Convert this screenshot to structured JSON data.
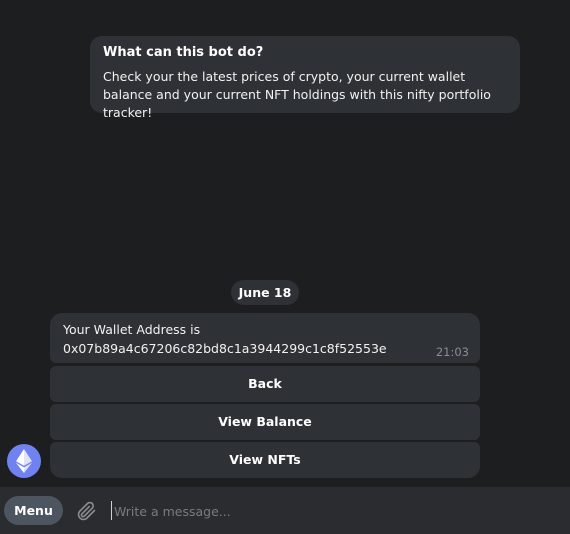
{
  "info_card": {
    "title": "What can this bot do?",
    "body": "Check your the latest prices of crypto, your current wallet balance and your current NFT holdings with this nifty portfolio tracker!"
  },
  "date_separator": "June 18",
  "message": {
    "line1": "Your Wallet Address is",
    "line2": "0x07b89a4c67206c82bd8c1a3944299c1c8f52553e",
    "time": "21:03"
  },
  "keyboard": {
    "buttons": [
      "Back",
      "View Balance",
      "View NFTs"
    ]
  },
  "bot_avatar": {
    "icon": "ethereum-icon",
    "color": "#6f82f0"
  },
  "composer": {
    "menu_label": "Menu",
    "attach_icon": "paperclip-icon",
    "placeholder": "Write a message..."
  }
}
